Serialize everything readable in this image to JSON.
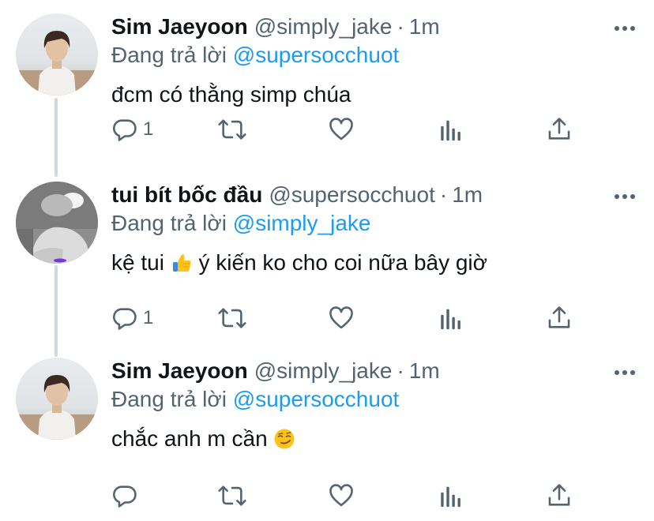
{
  "colors": {
    "accent": "#1d9bf0",
    "text_primary": "#0f1419",
    "text_secondary": "#536471",
    "thread_line": "#cfd9de"
  },
  "more_icon": "more-horizontal-icon",
  "tweets": [
    {
      "display_name": "Sim Jaeyoon",
      "handle": "@simply_jake",
      "separator": "·",
      "time": "1m",
      "replying_prefix": "Đang trả lời",
      "replying_to": "@supersocchuot",
      "text": "đcm có thằng simp chúa",
      "reply_count": "1"
    },
    {
      "display_name": "tui bít bốc đầu",
      "handle": "@supersocchuot",
      "separator": "·",
      "time": "1m",
      "replying_prefix": "Đang trả lời",
      "replying_to": "@simply_jake",
      "text_before_emoji": "kệ tui",
      "emoji": "thumbs-up",
      "text_after_emoji": "ý kiến ko cho coi nữa bây giờ",
      "reply_count": "1"
    },
    {
      "display_name": "Sim Jaeyoon",
      "handle": "@simply_jake",
      "separator": "·",
      "time": "1m",
      "replying_prefix": "Đang trả lời",
      "replying_to": "@supersocchuot",
      "text_before_emoji": "chắc anh m cần",
      "emoji": "smirking-face",
      "reply_count": ""
    }
  ],
  "action_icons": [
    "reply-icon",
    "retweet-icon",
    "like-icon",
    "analytics-icon",
    "share-icon"
  ]
}
